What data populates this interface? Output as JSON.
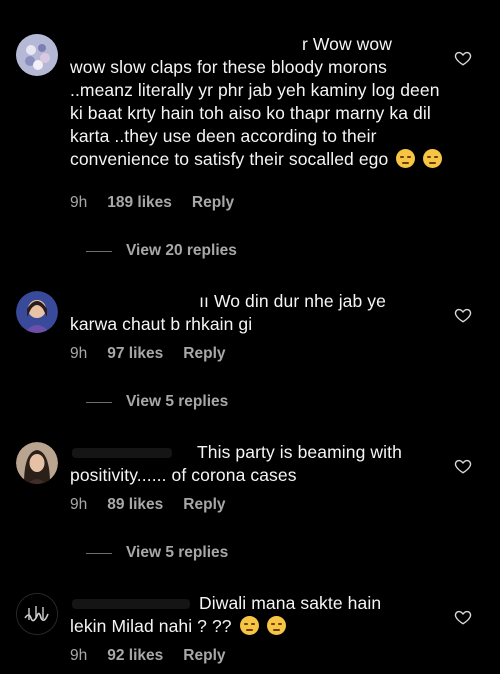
{
  "comments": [
    {
      "text_first": "r Wow wow",
      "text_rest": "wow slow claps for these bloody morons ..meanz literally yr phr jab yeh kaminy log deen ki baat krty hain toh aiso ko thapr marny ka dil karta ..they use deen according to their convenience to satisfy their socalled ego",
      "emojis": [
        "smirking-face-icon",
        "relieved-face-icon"
      ],
      "time": "9h",
      "likes": "189 likes",
      "reply": "Reply",
      "view_replies": "View 20 replies"
    },
    {
      "text_first": "ıı Wo din dur nhe jab ye",
      "text_rest": "karwa chaut b rhkain gi",
      "time": "9h",
      "likes": "97 likes",
      "reply": "Reply",
      "view_replies": "View 5 replies"
    },
    {
      "text_first": "This party is beaming with",
      "text_rest": "positivity...... of corona cases",
      "time": "9h",
      "likes": "89 likes",
      "reply": "Reply",
      "view_replies": "View 5 replies"
    },
    {
      "text_first": "Diwali mana sakte hain",
      "text_rest": "lekin Milad nahi ? ??",
      "emojis": [
        "thinking-face-icon",
        "face-with-monocle-icon"
      ],
      "time": "9h",
      "likes": "92 likes",
      "reply": "Reply"
    }
  ],
  "colors": {
    "background": "#000000",
    "text": "#f5f5f5",
    "secondary": "#a8a8a8"
  }
}
